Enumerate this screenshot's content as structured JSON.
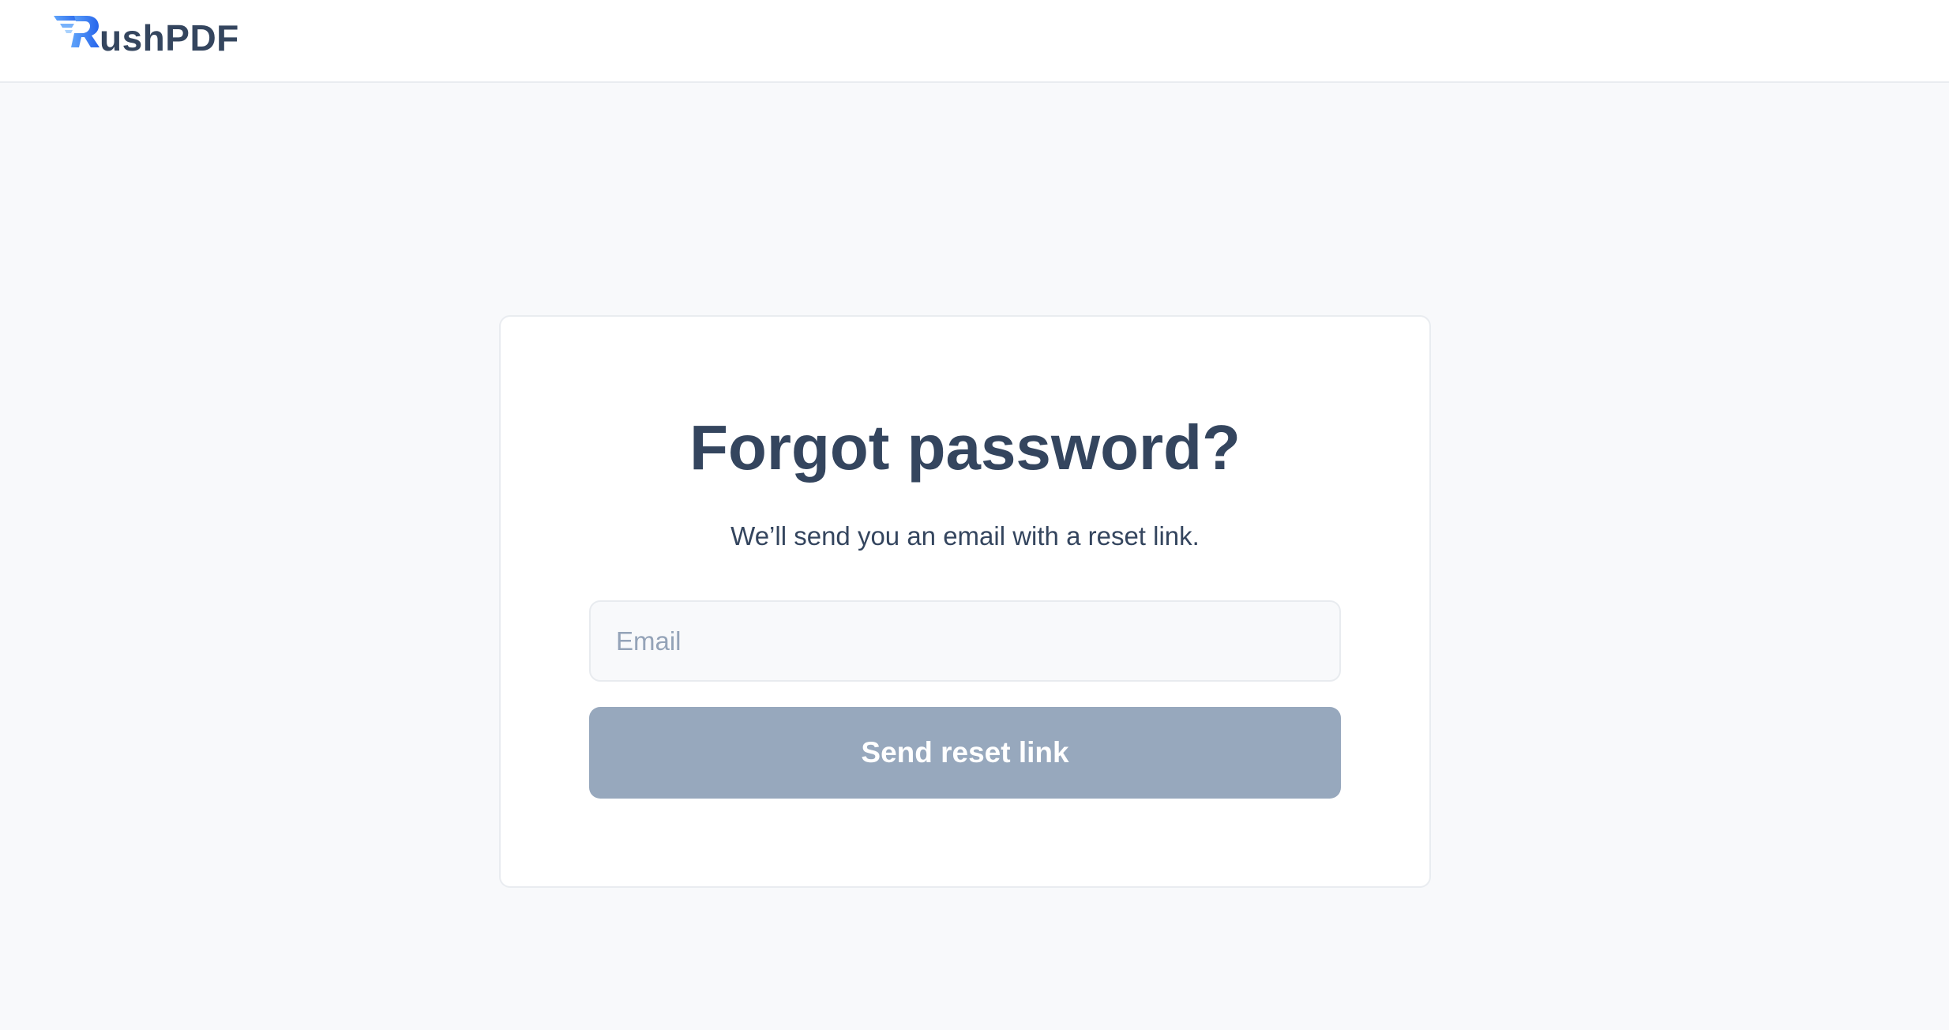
{
  "header": {
    "brand": "RushPDF",
    "brand_rest": "ushPDF"
  },
  "card": {
    "title": "Forgot password?",
    "subtitle": "We’ll send you an email with a reset link.",
    "email_placeholder": "Email",
    "email_value": "",
    "submit_label": "Send reset link",
    "submit_state": "disabled"
  },
  "colors": {
    "background": "#f8f9fb",
    "text_primary": "#34455e",
    "placeholder": "#94a3b8",
    "button_disabled": "#97a8bd",
    "brand_accent": "#3b82f6"
  },
  "icons": {
    "logo": "rushpdf-logo-icon"
  }
}
